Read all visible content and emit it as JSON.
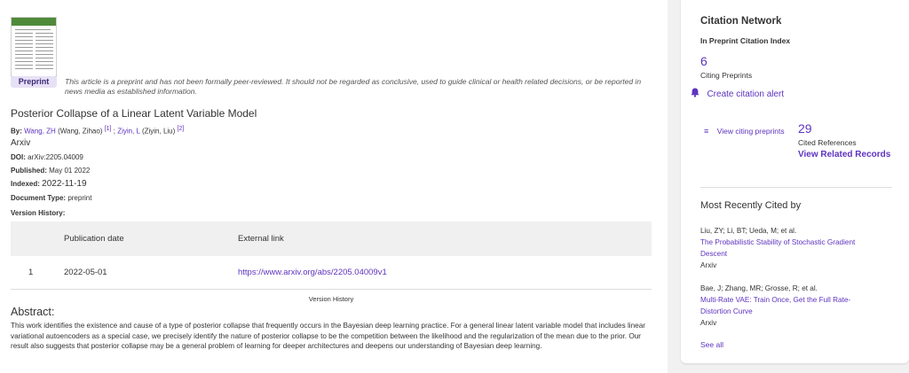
{
  "article": {
    "badge": "Preprint",
    "notice": "This article is a preprint and has not been formally peer-reviewed. It should not be regarded as conclusive, used to guide clinical or health related decisions, or be reported in news media as established information.",
    "title": "Posterior Collapse of a Linear Latent Variable Model",
    "by_label": "By:",
    "author1_link": "Wang, ZH",
    "author1_full": "(Wang, Zihao)",
    "author1_ref": "[1]",
    "separator": ";",
    "author2_link": "Ziyin, L",
    "author2_full": "(Ziyin, Liu)",
    "author2_ref": "[2]",
    "source": "Arxiv",
    "doi_label": "DOI:",
    "doi": "arXiv:2205.04009",
    "published_label": "Published:",
    "published": "May 01 2022",
    "indexed_label": "Indexed:",
    "indexed": "2022-11-19",
    "doctype_label": "Document Type:",
    "doctype": "preprint",
    "version_history_label": "Version History:"
  },
  "version_table": {
    "headers": [
      "",
      "Publication date",
      "External link"
    ],
    "rows": [
      {
        "num": "1",
        "date": "2022-05-01",
        "link": "https://www.arxiv.org/abs/2205.04009v1"
      }
    ],
    "caption": "Version History"
  },
  "abstract": {
    "heading": "Abstract:",
    "text": "This work identifies the existence and cause of a type of posterior collapse that frequently occurs in the Bayesian deep learning practice. For a general linear latent variable model that includes linear variational autoencoders as a special case, we precisely identify the nature of posterior collapse to be the competition between the likelihood and the regularization of the mean due to the prior. Our result also suggests that posterior collapse may be a general problem of learning for deeper architectures and deepens our understanding of Bayesian deep learning."
  },
  "sidebar": {
    "heading": "Citation Network",
    "subheading": "In Preprint Citation Index",
    "citing_count": "6",
    "citing_label": "Citing Preprints",
    "alert_label": "Create citation alert",
    "view_citing_label": "View citing preprints",
    "cited_refs_count": "29",
    "cited_refs_label": "Cited References",
    "view_related_label": "View Related Records",
    "recent_heading": "Most Recently Cited by",
    "recent": [
      {
        "authors": "Liu, ZY; Li, BT; Ueda, M; et al.",
        "title_line1": "The Probabilistic Stability of Stochastic Gradient",
        "title_line2": "Descent",
        "source": "Arxiv"
      },
      {
        "authors": "Bae, J; Zhang, MR; Grosse, R; et al.",
        "title_line1": "Multi-Rate VAE: Train Once, Get the Full Rate-",
        "title_line2": "Distortion Curve",
        "source": "Arxiv"
      }
    ],
    "see_all_label": "See all"
  },
  "colors": {
    "accent": "#5e33bf",
    "badge_bg": "#e6e1f6",
    "panel_bg": "#f1f1f1"
  }
}
